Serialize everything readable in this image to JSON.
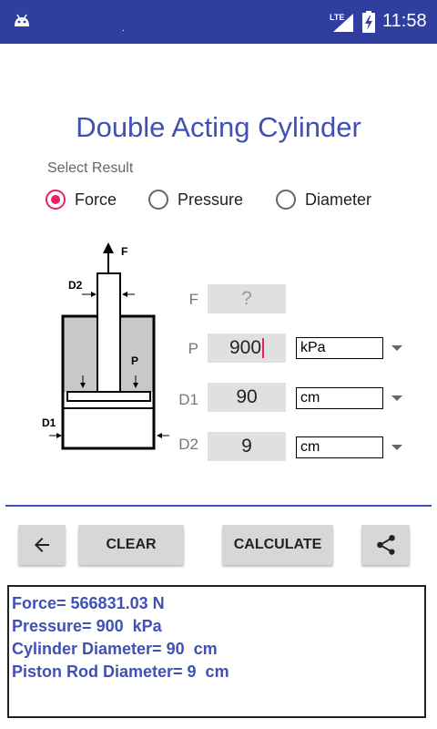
{
  "status_bar": {
    "network": "LTE",
    "time": "11:58"
  },
  "title": "Double Acting Cylinder",
  "select_result": {
    "label": "Select Result",
    "options": [
      {
        "label": "Force",
        "selected": true
      },
      {
        "label": "Pressure",
        "selected": false
      },
      {
        "label": "Diameter",
        "selected": false
      }
    ]
  },
  "diagram": {
    "labels": {
      "force": "F",
      "rod_diameter": "D2",
      "pressure": "P",
      "cylinder_diameter": "D1"
    }
  },
  "inputs": {
    "force": {
      "label": "F",
      "value": "?",
      "enabled": false
    },
    "pressure": {
      "label": "P",
      "value": "900",
      "unit": "kPa"
    },
    "cylinder_diameter": {
      "label": "D1",
      "value": "90",
      "unit": "cm"
    },
    "rod_diameter": {
      "label": "D2",
      "value": "9",
      "unit": "cm"
    }
  },
  "buttons": {
    "back_icon": "arrow-left-icon",
    "clear": "CLEAR",
    "calculate": "CALCULATE",
    "share_icon": "share-icon"
  },
  "results": [
    "Force= 566831.03 N",
    "Pressure= 900  kPa",
    "Cylinder Diameter= 90  cm",
    "Piston Rod Diameter= 9  cm"
  ],
  "colors": {
    "primary_dark": "#303f9f",
    "primary": "#3f51b5",
    "accent": "#e91e63"
  }
}
